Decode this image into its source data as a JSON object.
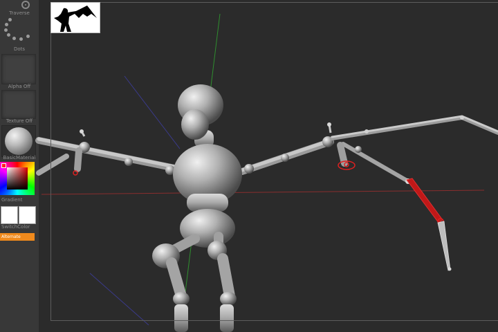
{
  "palette": {
    "traverse_label": "Traverse",
    "dots_label": "Dots",
    "alpha_label": "Alpha Off",
    "texture_label": "Texture Off",
    "material_label": "BasicMaterial",
    "gradient_label": "Gradient",
    "switch_color_label": "SwitchColor",
    "alternate_label": "Alternate"
  },
  "colors": {
    "background": "#2b2b2b",
    "palette_bg": "#383838",
    "accent_orange": "#f08a1c",
    "bone_red": "#e02020",
    "axis_green": "#2f8f2f",
    "axis_red": "#8a2e2e",
    "axis_blue": "#3a3a8a",
    "mesh_gray": "#b8b8b8"
  }
}
